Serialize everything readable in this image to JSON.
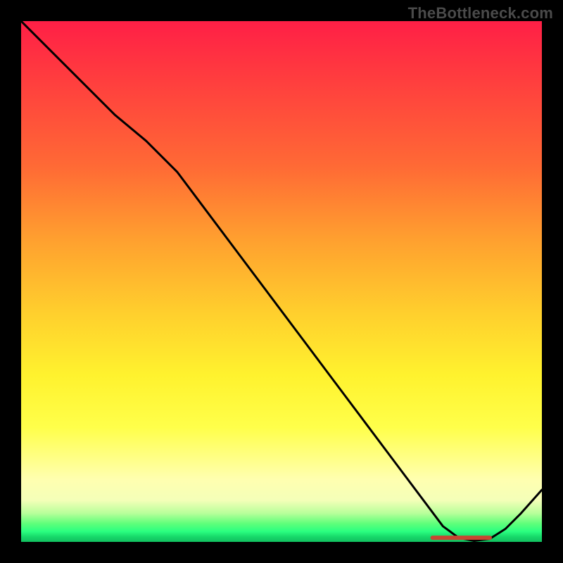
{
  "watermark": "TheBottleneck.com",
  "chart_data": {
    "type": "line",
    "title": "",
    "xlabel": "",
    "ylabel": "",
    "xlim": [
      0,
      100
    ],
    "ylim": [
      0,
      100
    ],
    "grid": false,
    "series": [
      {
        "name": "curve",
        "x": [
          0,
          6,
          12,
          18,
          24,
          30,
          36,
          42,
          48,
          54,
          60,
          66,
          72,
          78,
          81,
          84,
          87,
          90,
          93,
          96,
          100
        ],
        "y": [
          100,
          94,
          88,
          82,
          77,
          71,
          63,
          55,
          47,
          39,
          31,
          23,
          15,
          7,
          3,
          0.8,
          0.2,
          0.6,
          2.5,
          5.5,
          10
        ]
      }
    ],
    "marker": {
      "x_start": 79,
      "x_end": 90,
      "y": 0.8,
      "color": "#c74632"
    },
    "background_gradient": {
      "stops": [
        {
          "pos": 0.0,
          "color": "#ff1f46"
        },
        {
          "pos": 0.28,
          "color": "#ff6a35"
        },
        {
          "pos": 0.56,
          "color": "#ffcf2d"
        },
        {
          "pos": 0.78,
          "color": "#ffff4a"
        },
        {
          "pos": 0.92,
          "color": "#f4ffb8"
        },
        {
          "pos": 0.97,
          "color": "#5eff7a"
        },
        {
          "pos": 1.0,
          "color": "#12c060"
        }
      ]
    }
  }
}
